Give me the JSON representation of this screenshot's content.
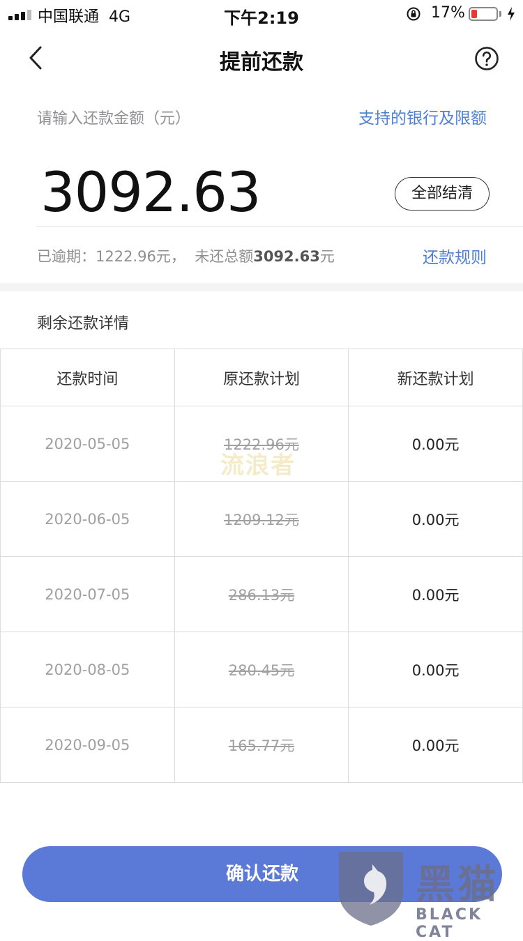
{
  "status_bar": {
    "carrier": "中国联通",
    "network": "4G",
    "time": "下午2:19",
    "battery_percent": "17%"
  },
  "nav": {
    "title": "提前还款"
  },
  "amount_section": {
    "input_label": "请输入还款金额（元）",
    "banks_link": "支持的银行及限额",
    "amount": "3092.63",
    "settle_all_label": "全部结清",
    "overdue_prefix": "已逾期：",
    "overdue_amount": "1222.96元，",
    "outstanding_prefix": "未还总额",
    "outstanding_amount": "3092.63",
    "outstanding_unit": "元",
    "rules_link": "还款规则"
  },
  "details": {
    "title": "剩余还款详情",
    "headers": [
      "还款时间",
      "原还款计划",
      "新还款计划"
    ],
    "rows": [
      {
        "date": "2020-05-05",
        "original": "1222.96元",
        "new": "0.00元"
      },
      {
        "date": "2020-06-05",
        "original": "1209.12元",
        "new": "0.00元"
      },
      {
        "date": "2020-07-05",
        "original": "286.13元",
        "new": "0.00元"
      },
      {
        "date": "2020-08-05",
        "original": "280.45元",
        "new": "0.00元"
      },
      {
        "date": "2020-09-05",
        "original": "165.77元",
        "new": "0.00元"
      }
    ]
  },
  "watermark": "流浪者",
  "confirm_label": "确认还款",
  "logo": {
    "title": "黑猫",
    "subtitle": "BLACK CAT"
  },
  "colors": {
    "accent": "#4f80d4",
    "button": "#5b7ad8",
    "battery_low": "#e53b30"
  }
}
